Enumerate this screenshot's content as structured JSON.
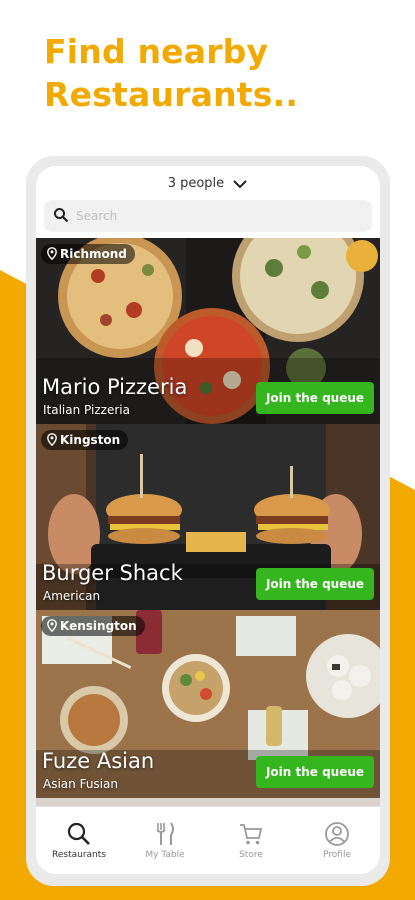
{
  "promo": {
    "headline_line1": "Find nearby",
    "headline_line2": "Restaurants.."
  },
  "colors": {
    "accent": "#F2A900",
    "join_button": "#35B51E"
  },
  "header": {
    "party_size": "3 people",
    "party_icon": "chevron-down-icon"
  },
  "search": {
    "placeholder": "Search",
    "value": ""
  },
  "restaurants": [
    {
      "location": "Richmond",
      "name": "Mario Pizzeria",
      "cuisine": "Italian Pizzeria",
      "action": "Join the queue"
    },
    {
      "location": "Kingston",
      "name": "Burger Shack",
      "cuisine": "American",
      "action": "Join the queue"
    },
    {
      "location": "Kensington",
      "name": "Fuze Asian",
      "cuisine": "Asian Fusian",
      "action": "Join the queue"
    }
  ],
  "tabs": [
    {
      "label": "Restaurants",
      "icon": "search-icon",
      "active": true
    },
    {
      "label": "My Table",
      "icon": "fork-knife-icon",
      "active": false
    },
    {
      "label": "Store",
      "icon": "cart-icon",
      "active": false
    },
    {
      "label": "Profile",
      "icon": "profile-icon",
      "active": false
    }
  ]
}
